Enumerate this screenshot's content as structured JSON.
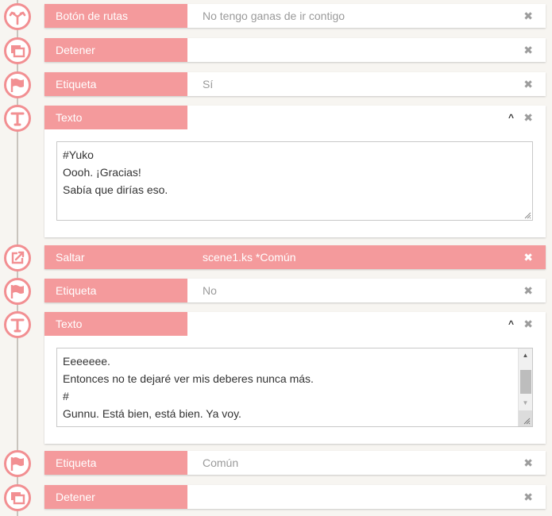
{
  "commands": [
    {
      "label": "Botón de rutas",
      "value": "No tengo ganas de ir contigo",
      "icon": "route-button-icon"
    },
    {
      "label": "Detener",
      "value": "",
      "icon": "stop-icon"
    },
    {
      "label": "Etiqueta",
      "value": "Sí",
      "icon": "flag-icon"
    },
    {
      "label": "Texto",
      "value": "",
      "icon": "text-icon",
      "expanded": true
    },
    {
      "label": "Saltar",
      "value": "scene1.ks *Común",
      "icon": "jump-icon",
      "selected": true
    },
    {
      "label": "Etiqueta",
      "value": "No",
      "icon": "flag-icon"
    },
    {
      "label": "Texto",
      "value": "",
      "icon": "text-icon",
      "expanded": true
    },
    {
      "label": "Etiqueta",
      "value": "Común",
      "icon": "flag-icon"
    },
    {
      "label": "Detener",
      "value": "",
      "icon": "stop-icon"
    }
  ],
  "text_blocks": [
    {
      "lines": [
        "#Yuko",
        "Oooh. ¡Gracias!",
        "Sabía que dirías eso."
      ]
    },
    {
      "lines": [
        "Eeeeeee.",
        "Entonces no te dejaré ver mis deberes nunca más.",
        "#",
        "Gunnu. Está bien, está bien. Ya voy."
      ]
    }
  ],
  "glyphs": {
    "close": "✖",
    "collapse": "^",
    "scroll_up": "▲",
    "scroll_down": "▼"
  },
  "colors": {
    "accent": "#f49a9c",
    "ring": "#f28f92",
    "timeline": "#c9c4bd",
    "background": "#f7f5f1"
  }
}
